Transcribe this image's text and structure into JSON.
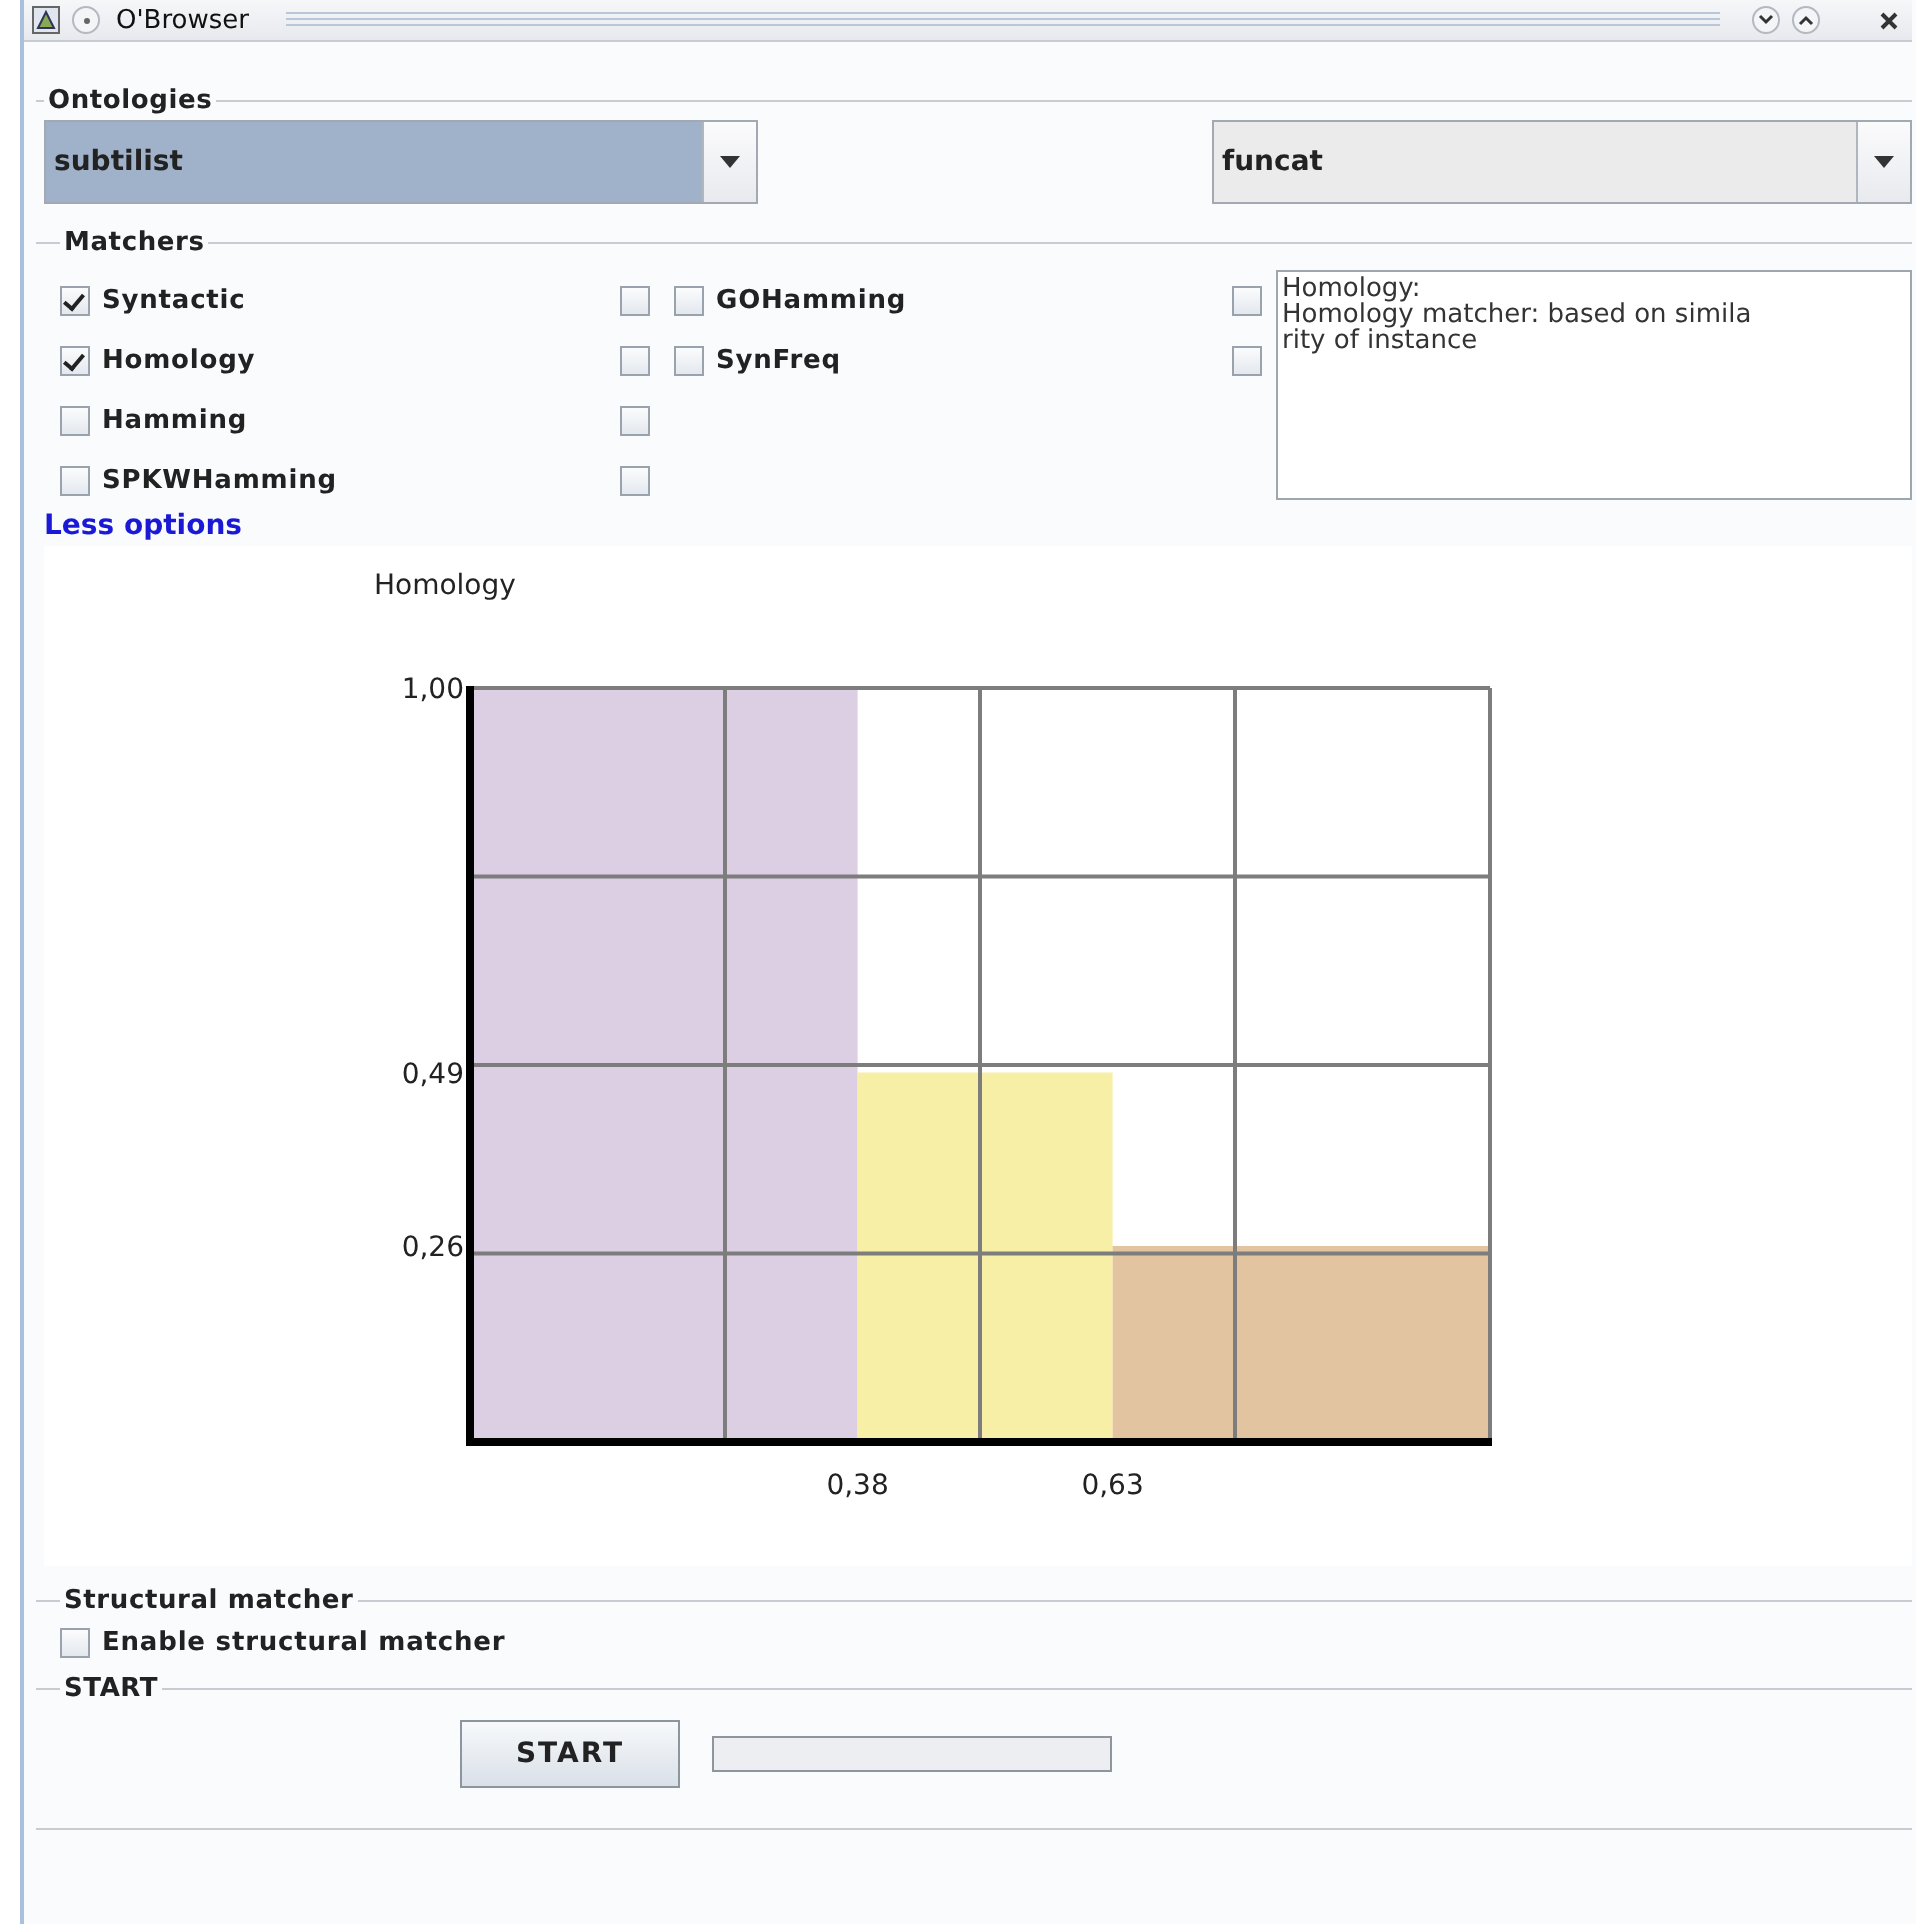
{
  "window": {
    "title": "O'Browser"
  },
  "ontologies": {
    "title": "Ontologies",
    "combos": [
      {
        "value": "subtilist",
        "selected": true
      },
      {
        "value": "funcat",
        "selected": false
      }
    ]
  },
  "matchers": {
    "title": "Matchers",
    "primary": [
      {
        "label": "Syntactic",
        "checked": true,
        "extra_checked": false
      },
      {
        "label": "Homology",
        "checked": true,
        "extra_checked": false
      },
      {
        "label": "Hamming",
        "checked": false,
        "extra_checked": false
      },
      {
        "label": "SPKWHamming",
        "checked": false,
        "extra_checked": false
      }
    ],
    "secondary": [
      {
        "label": "GOHamming",
        "checked": false
      },
      {
        "label": "SynFreq",
        "checked": false
      }
    ],
    "side_checks": [
      {
        "checked": false
      },
      {
        "checked": false
      }
    ],
    "description": [
      "Homology:",
      "Homology matcher: based on simila",
      "rity of instance"
    ],
    "toggle_link": "Less options",
    "chart_data": {
      "type": "area",
      "ylabel": "Homology",
      "xlim": [
        0,
        1
      ],
      "ylim": [
        0,
        1
      ],
      "series": [
        {
          "color": "#dccfe3",
          "x": [
            0,
            0.38
          ],
          "values": [
            1.0,
            1.0
          ]
        },
        {
          "color": "#f8efa6",
          "x": [
            0.38,
            0.63
          ],
          "values": [
            0.49,
            0.49
          ]
        },
        {
          "color": "#e3c4a0",
          "x": [
            0.63,
            1.0
          ],
          "values": [
            0.26,
            0.26
          ]
        }
      ],
      "xticks": [
        {
          "value": 0.38,
          "label": "0,38"
        },
        {
          "value": 0.63,
          "label": "0,63"
        }
      ],
      "yticks": [
        {
          "value": 0.26,
          "label": "0,26"
        },
        {
          "value": 0.49,
          "label": "0,49"
        },
        {
          "value": 1.0,
          "label": "1,00"
        }
      ]
    }
  },
  "structural": {
    "title": "Structural matcher",
    "checkbox": {
      "label": "Enable structural matcher",
      "checked": false
    }
  },
  "start": {
    "title": "START",
    "button": "START",
    "progress": {
      "level": 0
    }
  }
}
